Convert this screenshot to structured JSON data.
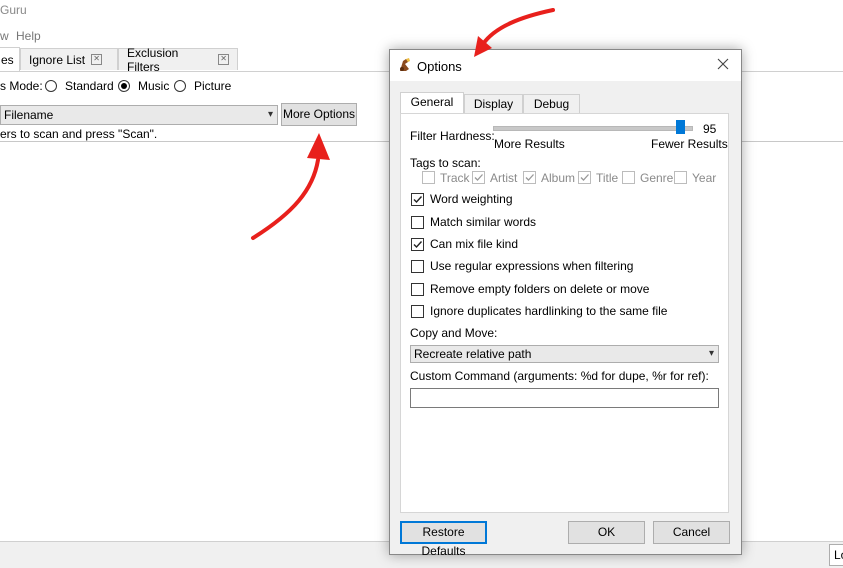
{
  "app": {
    "title": "Guru",
    "menu": [
      "w",
      "Help"
    ],
    "tabs": [
      {
        "label": "es"
      },
      {
        "label": "Ignore List"
      },
      {
        "label": "Exclusion Filters"
      }
    ],
    "mode_label": "s Mode:",
    "modes": [
      {
        "label": "Standard",
        "selected": false
      },
      {
        "label": "Music",
        "selected": true
      },
      {
        "label": "Picture",
        "selected": false
      }
    ],
    "scan_type_value": "Filename",
    "more_options_label": "More Options",
    "hint": "ers to scan and press \"Scan\".",
    "status_button_label": "Lo"
  },
  "dialog": {
    "title": "Options",
    "tabs": [
      "General",
      "Display",
      "Debug"
    ],
    "filter_hardness": {
      "label": "Filter Hardness:",
      "value": 95,
      "min_label": "More Results",
      "max_label": "Fewer Results",
      "fraction": 0.95
    },
    "tags": {
      "label": "Tags to scan:",
      "items": [
        {
          "label": "Track",
          "checked": false
        },
        {
          "label": "Artist",
          "checked": true
        },
        {
          "label": "Album",
          "checked": true
        },
        {
          "label": "Title",
          "checked": true
        },
        {
          "label": "Genre",
          "checked": false
        },
        {
          "label": "Year",
          "checked": false
        }
      ]
    },
    "options": [
      {
        "label": "Word weighting",
        "checked": true
      },
      {
        "label": "Match similar words",
        "checked": false
      },
      {
        "label": "Can mix file kind",
        "checked": true
      },
      {
        "label": "Use regular expressions when filtering",
        "checked": false
      },
      {
        "label": "Remove empty folders on delete or move",
        "checked": false
      },
      {
        "label": "Ignore duplicates hardlinking to the same file",
        "checked": false
      }
    ],
    "copy_move": {
      "label": "Copy and Move:",
      "value": "Recreate relative path"
    },
    "custom_command": {
      "label": "Custom Command (arguments: %d for dupe, %r for ref):",
      "value": ""
    },
    "buttons": {
      "restore": "Restore Defaults",
      "ok": "OK",
      "cancel": "Cancel"
    }
  },
  "colors": {
    "annotation_arrow": "#e8201c",
    "slider_accent": "#0078d7",
    "focus_border": "#0078d7"
  }
}
